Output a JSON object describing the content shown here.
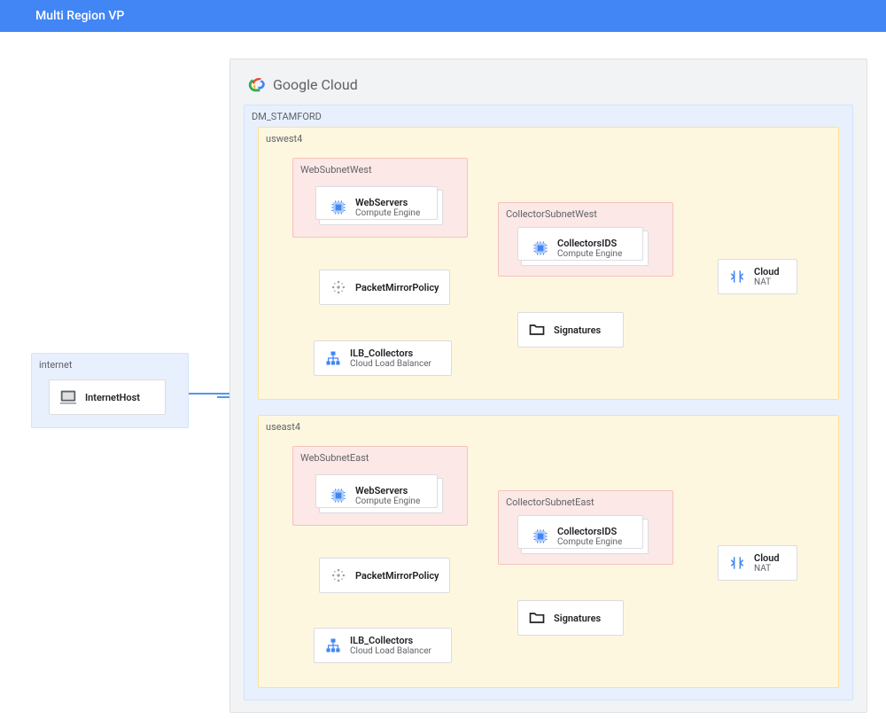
{
  "header": {
    "title": "Multi Region VP"
  },
  "cloud": {
    "brand": "Google Cloud"
  },
  "vpc": {
    "name": "DM_STAMFORD"
  },
  "internet": {
    "label": "internet",
    "host": {
      "title": "InternetHost"
    }
  },
  "regions": {
    "west": {
      "name": "uswest4",
      "webSubnet": {
        "name": "WebSubnetWest",
        "webServers": {
          "title": "WebServers",
          "sub": "Compute Engine"
        }
      },
      "packetMirror": {
        "title": "PacketMirrorPolicy"
      },
      "ilb": {
        "title": "ILB_Collectors",
        "sub": "Cloud Load Balancer"
      },
      "collectorSubnet": {
        "name": "CollectorSubnetWest",
        "collectors": {
          "title": "CollectorsIDS",
          "sub": "Compute Engine"
        }
      },
      "signatures": {
        "title": "Signatures"
      },
      "nat": {
        "title": "Cloud",
        "sub": "NAT"
      }
    },
    "east": {
      "name": "useast4",
      "webSubnet": {
        "name": "WebSubnetEast",
        "webServers": {
          "title": "WebServers",
          "sub": "Compute Engine"
        }
      },
      "packetMirror": {
        "title": "PacketMirrorPolicy"
      },
      "ilb": {
        "title": "ILB_Collectors",
        "sub": "Cloud Load Balancer"
      },
      "collectorSubnet": {
        "name": "CollectorSubnetEast",
        "collectors": {
          "title": "CollectorsIDS",
          "sub": "Compute Engine"
        }
      },
      "signatures": {
        "title": "Signatures"
      },
      "nat": {
        "title": "Cloud",
        "sub": "NAT"
      }
    }
  }
}
